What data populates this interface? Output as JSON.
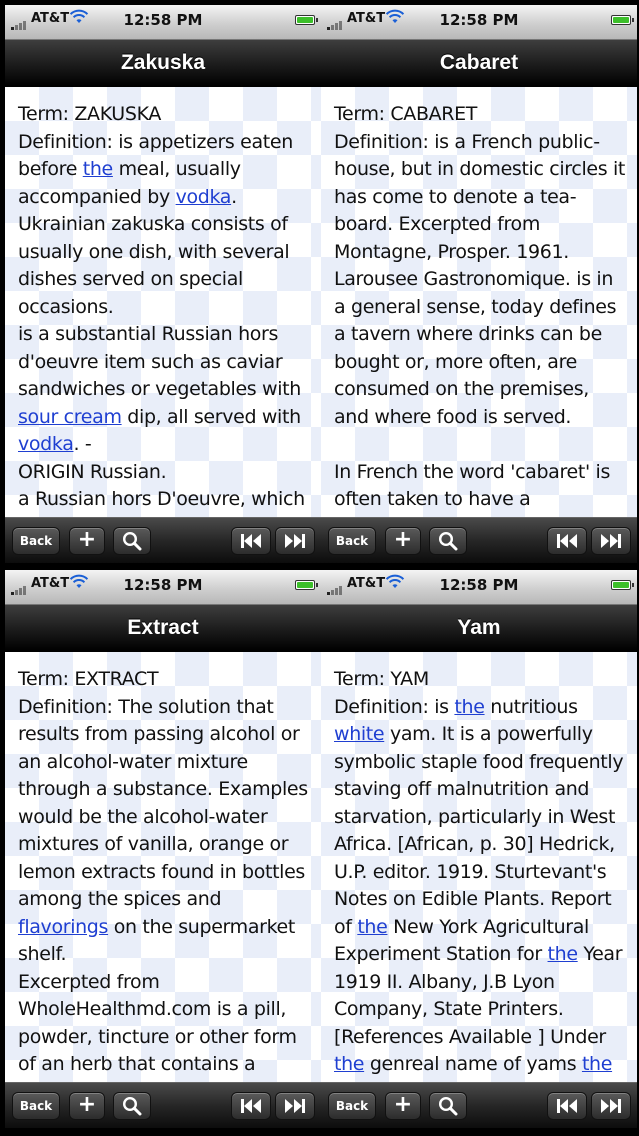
{
  "status": {
    "carrier": "AT&T",
    "time": "12:58 PM"
  },
  "toolbar": {
    "back_label": "Back",
    "add_label": "+"
  },
  "panels": [
    {
      "title": "Zakuska",
      "html": "Term: ZAKUSKA<br>Definition: is appetizers eaten before <a>the</a> meal, usually accompanied by <a>vodka</a>. Ukrainian zakuska consists of usually one dish, with several dishes served on special occasions.<br>is a substantial Russian hors d'oeuvre item such as caviar sandwiches or vegetables with <a>sour cream</a> dip, all served with <a>vodka</a>. -<br>ORIGIN Russian.<br>a Russian hors D'oeuvre, which"
    },
    {
      "title": "Cabaret",
      "html": "Term: CABARET<br>Definition: is a French public-house, but in domestic circles it has come to denote a tea-board. Excerpted from Montagne, Prosper. 1961. Larousee Gastronomique. is in a general sense, today defines a tavern where drinks can be bought or, more often, are consumed on the premises, and where food is served.<br><br>In French the word 'cabaret' is often taken to have a"
    },
    {
      "title": "Extract",
      "html": "Term: EXTRACT<br>Definition: The solution that results from passing alcohol or an alcohol-water mixture through a substance. Examples would be the alcohol-water mixtures of vanilla, orange or lemon extracts found in bottles among the spices and <a>flavorings</a> on the supermarket shelf.<br>Excerpted from WholeHealthmd.com is a pill, powder, tincture or other form of an herb that contains a concentrated, and usually"
    },
    {
      "title": "Yam",
      "html": "Term: YAM<br>Definition: is <a>the</a> nutritious <a>white</a> yam. It is a powerfully symbolic staple food frequently staving off malnutrition and starvation, particularly in West Africa. [African, p. 30] Hedrick, U.P. editor. 1919. Sturtevant's Notes on Edible Plants. Report of <a>the</a> New York Agricultural Experiment Station for <a>the</a> Year 1919 II. Albany, J.B Lyon Company, State Printers. [References Available ] Under <a>the</a> genreal name of yams <a>the</a>"
    }
  ]
}
